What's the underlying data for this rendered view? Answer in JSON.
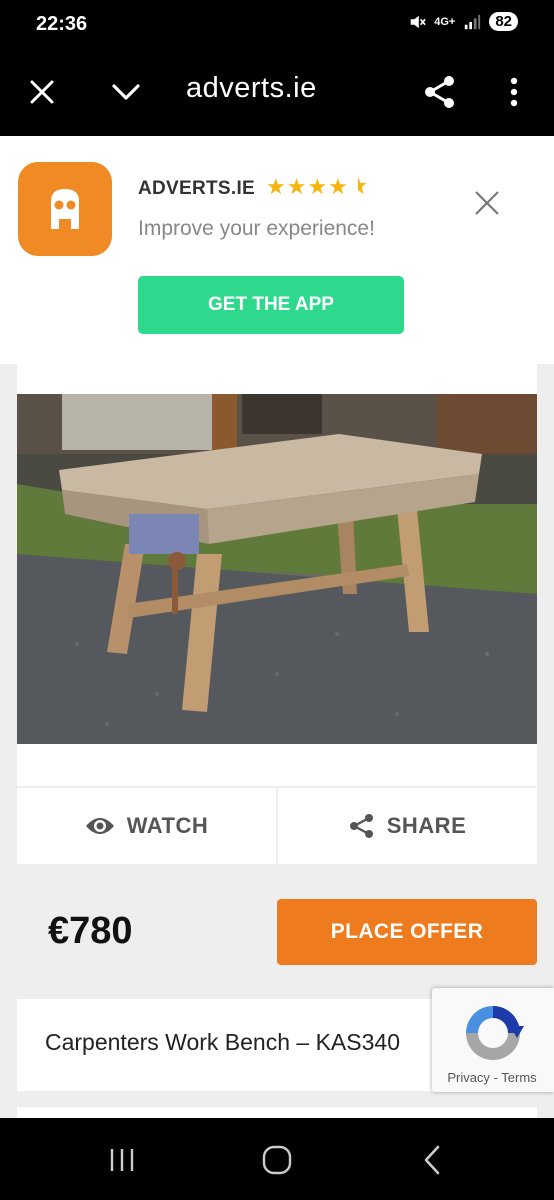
{
  "status_bar": {
    "time": "22:36",
    "network": "4G+",
    "battery": "82"
  },
  "browser": {
    "url": "adverts.ie"
  },
  "app_banner": {
    "app_name": "ADVERTS.IE",
    "rating_stars": "★★★★",
    "subtitle": "Improve your experience!",
    "cta": "GET THE APP"
  },
  "listing": {
    "watch_label": "WATCH",
    "share_label": "SHARE",
    "price": "€780",
    "offer_label": "PLACE OFFER",
    "title": "Carpenters Work Bench – KAS340"
  },
  "recaptcha": {
    "privacy": "Privacy",
    "separator": "-",
    "terms": "Terms"
  },
  "colors": {
    "accent_green": "#2ed98d",
    "accent_orange": "#ee7b1d",
    "logo_orange": "#f08a24",
    "star": "#f5b50a"
  }
}
